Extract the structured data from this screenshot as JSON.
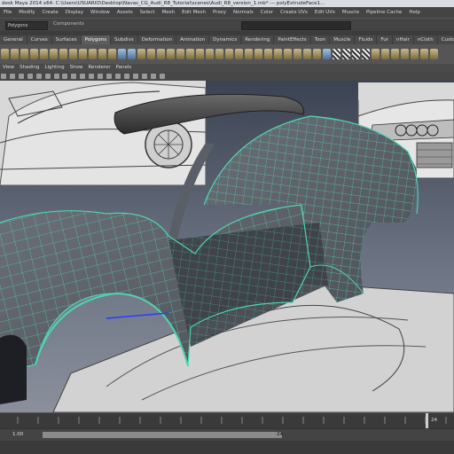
{
  "window": {
    "title": "desk Maya 2014 x64: C:\\Users\\USUARIO\\Desktop\\Navas_CG_Audi_R8_Tutorial\\scenes\\Audi_R8_version_1.mb* --- polyExtrudeFace1..."
  },
  "menubar": {
    "items": [
      "File",
      "Modify",
      "Create",
      "Display",
      "Window",
      "Assets",
      "Select",
      "Mesh",
      "Edit Mesh",
      "Proxy",
      "Normals",
      "Color",
      "Create UVs",
      "Edit UVs",
      "Muscle",
      "Pipeline Cache",
      "Help"
    ]
  },
  "status_line": {
    "mode": "Polygons",
    "selection_mode_label": "Components"
  },
  "shelf": {
    "tabs": [
      "General",
      "Curves",
      "Surfaces",
      "Polygons",
      "Subdivs",
      "Deformation",
      "Animation",
      "Dynamics",
      "Rendering",
      "PaintEffects",
      "Toon",
      "Muscle",
      "Fluids",
      "Fur",
      "nHair",
      "nCloth",
      "Custom"
    ],
    "active_tab": "Polygons"
  },
  "panel_menu": {
    "items": [
      "View",
      "Shading",
      "Lighting",
      "Show",
      "Renderer",
      "Panels"
    ]
  },
  "time_slider": {
    "current_frame": "24"
  },
  "range_slider": {
    "start": "1.00",
    "end": "24"
  },
  "colors": {
    "wireframe": "#4fd4b0",
    "viewport_top": "#3b4352",
    "viewport_bottom": "#8a8f9b",
    "shelf_icon": "#b3a473"
  },
  "viewport": {
    "content": "car modeling reference images with polygon mesh body panel"
  }
}
